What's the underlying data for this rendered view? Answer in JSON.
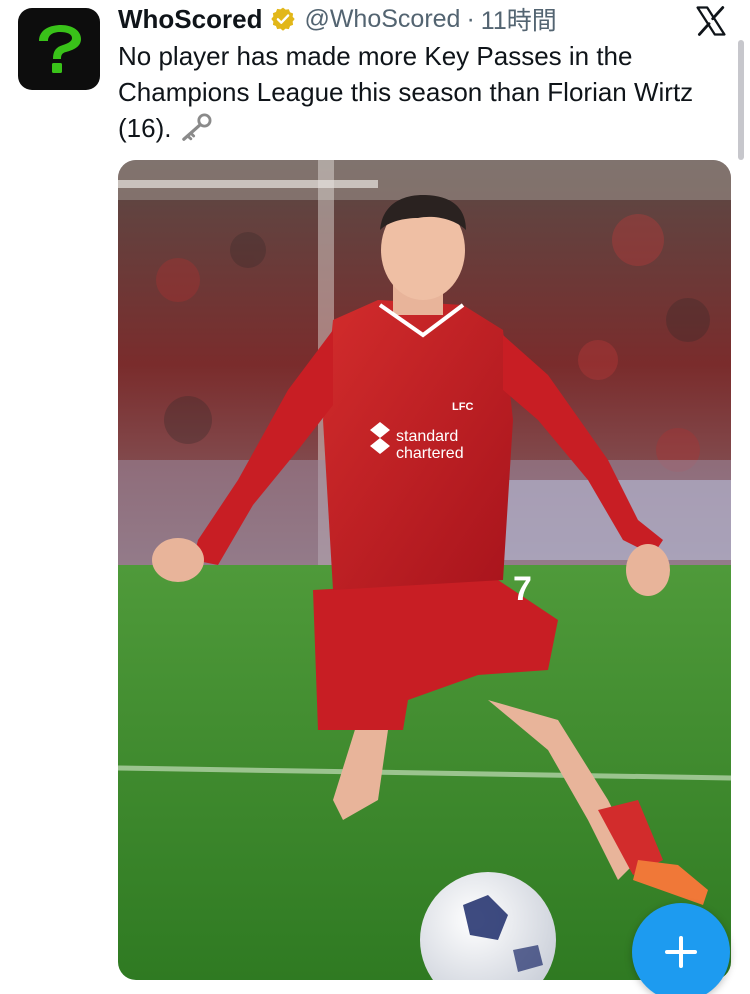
{
  "tweet": {
    "display_name": "WhoScored",
    "handle": "@WhoScored",
    "separator": "·",
    "timestamp": "11時間",
    "text": "No player has made more Key Passes in the Champions League this season than Florian Wirtz (16).",
    "emoji": "key-icon"
  },
  "media": {
    "sponsor_line1": "standard",
    "sponsor_line2": "chartered",
    "crest_text": "LFC",
    "shirt_number": "7"
  },
  "colors": {
    "accent": "#1d9bf0",
    "verified": "#e2b719",
    "avatar_bg": "#0d0d0d",
    "avatar_mark": "#39c219",
    "text": "#0f1419",
    "secondary_text": "#536471"
  },
  "icons": {
    "avatar": "question-mark-logo",
    "verified": "verified-badge-icon",
    "brand": "x-logo-icon",
    "fab": "plus-icon"
  }
}
